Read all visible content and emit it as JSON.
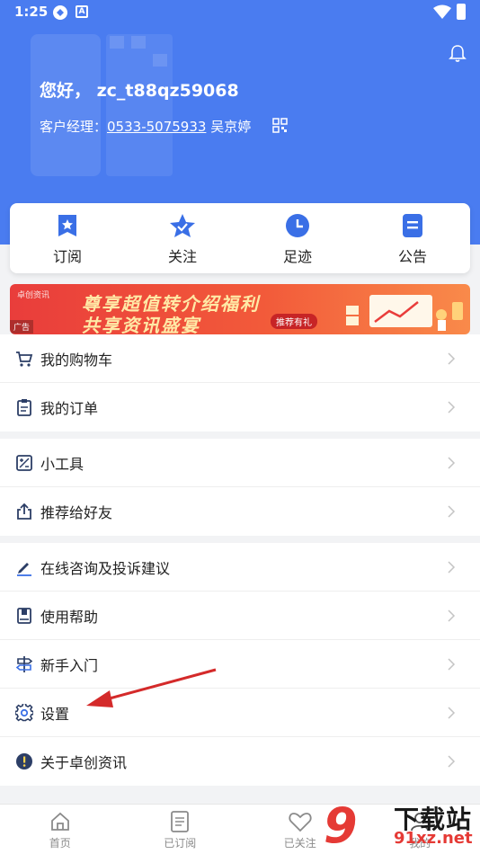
{
  "status_bar": {
    "time": "1:25",
    "notification_icon": "A"
  },
  "header": {
    "greeting": "您好， zc_t88qz59068",
    "manager_label": "客户经理：",
    "manager_phone": "0533-5075933",
    "manager_name": "吴京婷",
    "colors": {
      "background": "#4a7cf0"
    }
  },
  "quick_actions": [
    {
      "label": "订阅",
      "icon": "star-badge-icon"
    },
    {
      "label": "关注",
      "icon": "star-check-icon"
    },
    {
      "label": "足迹",
      "icon": "clock-icon"
    },
    {
      "label": "公告",
      "icon": "notice-doc-icon"
    }
  ],
  "banner": {
    "logo_text": "卓创资讯",
    "line1": "尊享超值转介绍福利",
    "line2": "共享资讯盛宴",
    "tag": "推荐有礼",
    "ad_label": "广告"
  },
  "menu_groups": [
    {
      "items": [
        {
          "label": "我的购物车",
          "icon": "cart-icon"
        },
        {
          "label": "我的订单",
          "icon": "order-clipboard-icon"
        }
      ]
    },
    {
      "items": [
        {
          "label": "小工具",
          "icon": "tools-icon"
        },
        {
          "label": "推荐给好友",
          "icon": "share-icon"
        }
      ]
    },
    {
      "items": [
        {
          "label": "在线咨询及投诉建议",
          "icon": "pen-icon"
        },
        {
          "label": "使用帮助",
          "icon": "help-book-icon"
        },
        {
          "label": "新手入门",
          "icon": "signpost-icon"
        },
        {
          "label": "设置",
          "icon": "gear-icon"
        },
        {
          "label": "关于卓创资讯",
          "icon": "info-icon"
        }
      ]
    }
  ],
  "tab_bar": [
    {
      "label": "首页",
      "icon": "home-icon"
    },
    {
      "label": "已订阅",
      "icon": "subscribed-icon"
    },
    {
      "label": "已关注",
      "icon": "heart-icon"
    },
    {
      "label": "我的",
      "icon": "user-icon"
    }
  ],
  "watermark": {
    "number": "9",
    "title": "下载站",
    "url": "91xz.net"
  },
  "colors": {
    "accent": "#3a6fe6",
    "arrow": "#d42a2a"
  }
}
